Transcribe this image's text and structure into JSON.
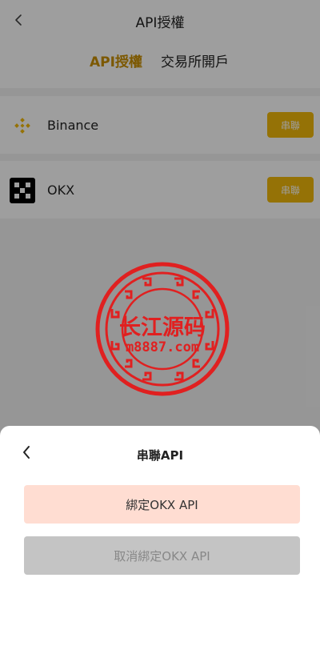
{
  "header": {
    "title": "API授權"
  },
  "tabs": [
    {
      "label": "API授權",
      "active": true
    },
    {
      "label": "交易所開戶",
      "active": false
    }
  ],
  "exchanges": [
    {
      "name": "Binance",
      "icon": "binance-icon",
      "action_label": "串聯"
    },
    {
      "name": "OKX",
      "icon": "okx-icon",
      "action_label": "串聯"
    }
  ],
  "watermark": {
    "line1": "长江源码",
    "line2": "m8887.com"
  },
  "sheet": {
    "title": "串聯API",
    "bind_label": "綁定OKX API",
    "unbind_label": "取消綁定OKX API"
  },
  "colors": {
    "accent": "#f0b90b",
    "tab_active": "#c98f00",
    "bind_bg": "#ffddd2",
    "unbind_bg": "#c4c4c4",
    "watermark": "#e02020"
  }
}
